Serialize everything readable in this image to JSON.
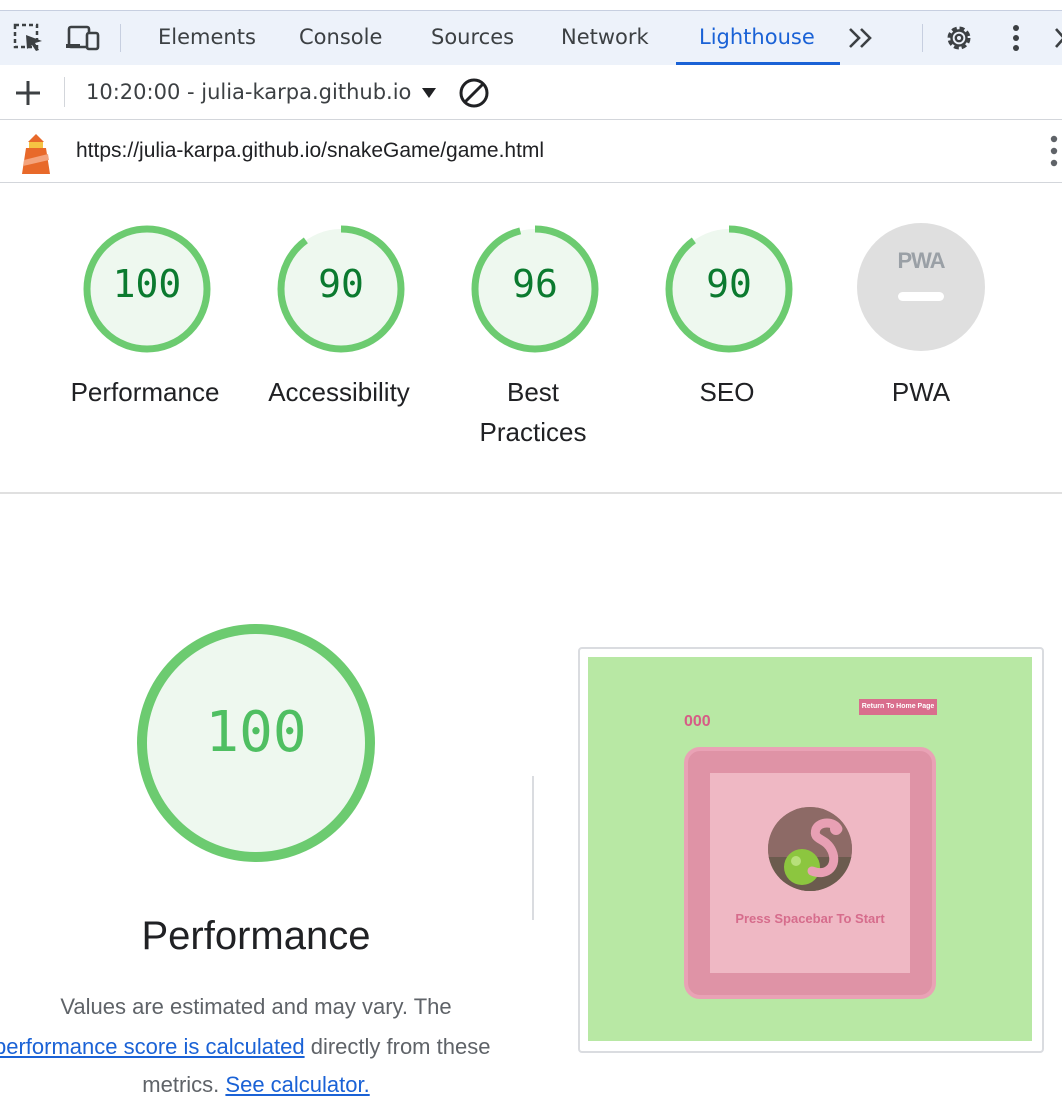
{
  "devtools": {
    "tabs": [
      {
        "label": "Elements"
      },
      {
        "label": "Console"
      },
      {
        "label": "Sources"
      },
      {
        "label": "Network"
      },
      {
        "label": "Lighthouse",
        "active": true
      }
    ],
    "overflow_icon": "chevron-double-right-icon",
    "active_tab_color": "#1a62d6"
  },
  "toolbar": {
    "report_selector": "10:20:00 - julia-karpa.github.io"
  },
  "urlbar": {
    "url": "https://julia-karpa.github.io/snakeGame/game.html"
  },
  "scores": [
    {
      "label": "Performance",
      "value": "100",
      "fraction": 1.0
    },
    {
      "label": "Accessibility",
      "value": "90",
      "fraction": 0.9
    },
    {
      "label": "Best Practices",
      "value": "96",
      "fraction": 0.96
    },
    {
      "label": "SEO",
      "value": "90",
      "fraction": 0.9
    }
  ],
  "pwa": {
    "label": "PWA",
    "badge": "PWA"
  },
  "colors": {
    "pass": "#0b7a2f",
    "pass_ring": "#6ccb70",
    "pass_bg": "#eef8ef"
  },
  "performance": {
    "score": "100",
    "fraction": 1.0,
    "title": "Performance",
    "desc_line1": "Values are estimated and may vary. The",
    "link_score": "performance score is calculated",
    "desc_line2_rest": " directly from these",
    "desc_line3_start": "metrics. ",
    "link_calc": "See calculator."
  },
  "thumbnail": {
    "score_text": "000",
    "home_button": "Return To Home Page",
    "press_text": "Press Spacebar To Start"
  }
}
